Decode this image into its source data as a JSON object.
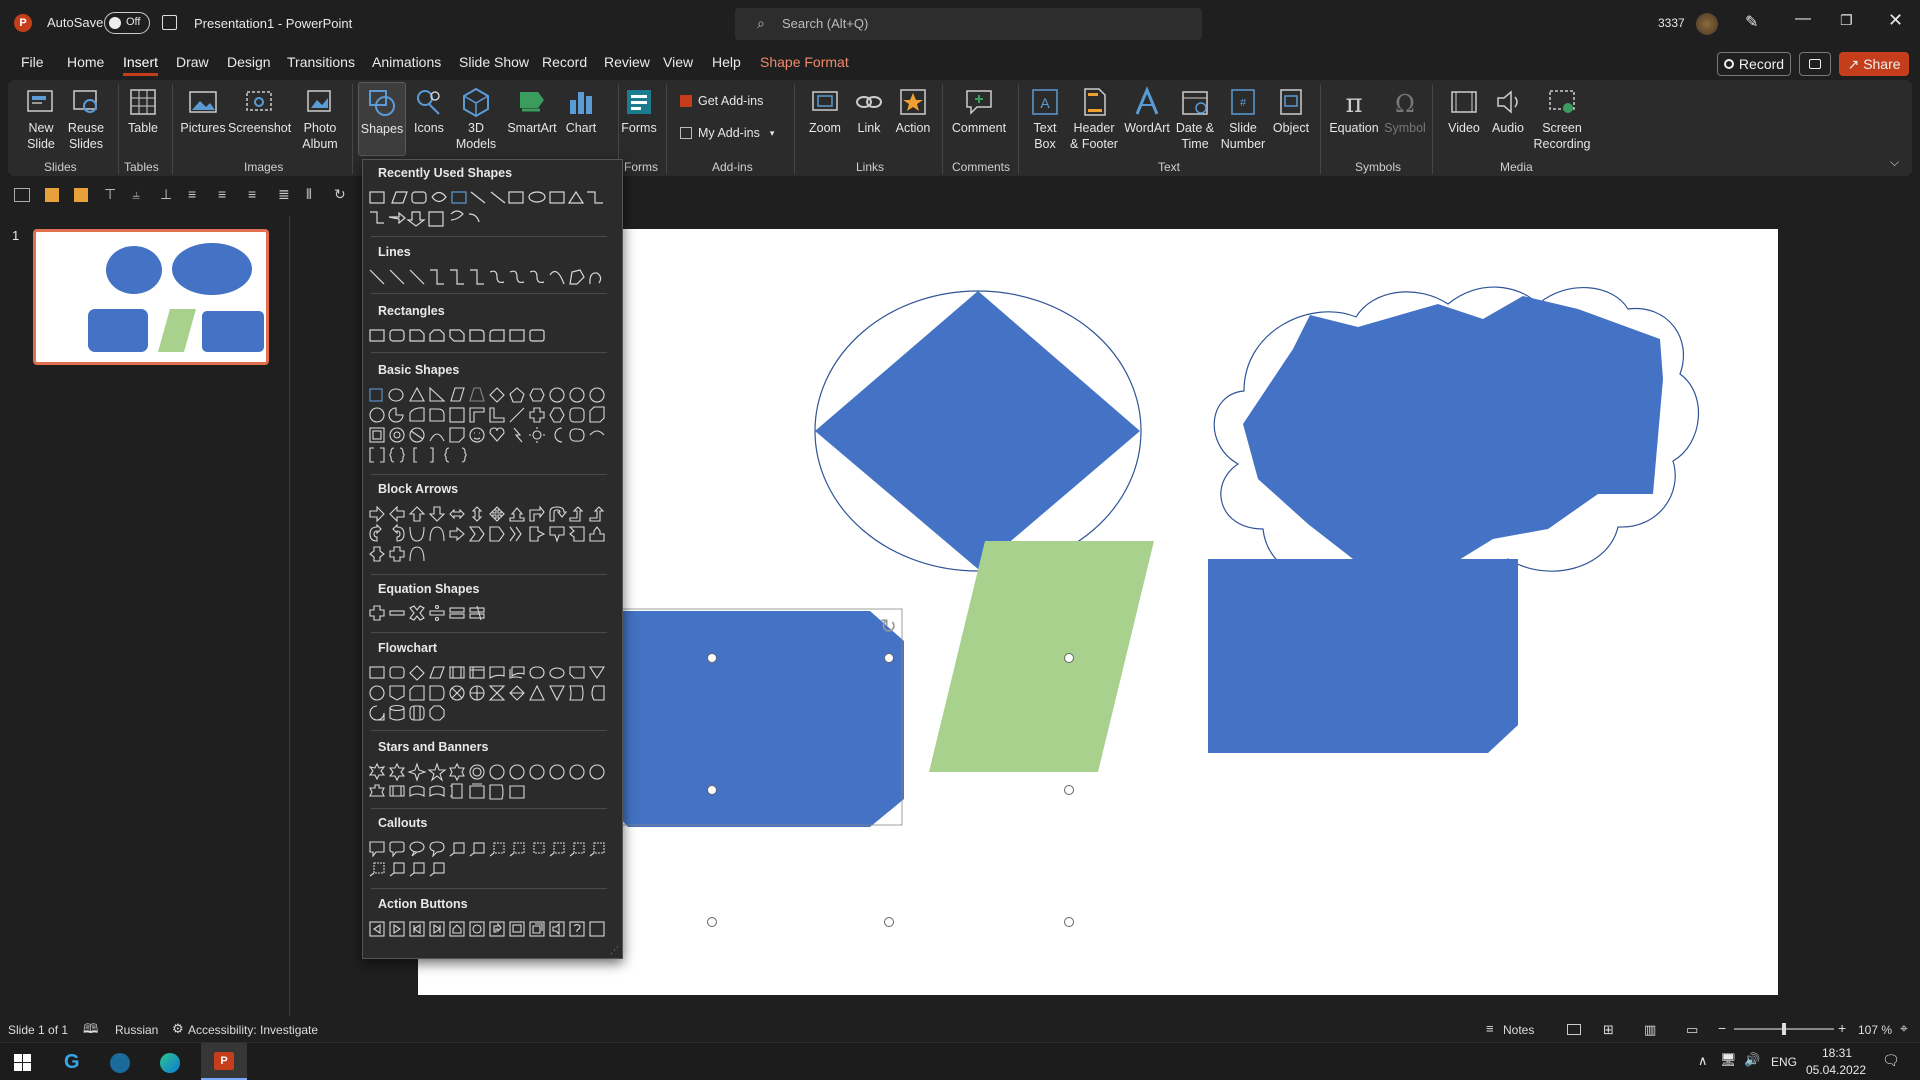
{
  "titlebar": {
    "autosave_label": "AutoSave",
    "autosave_state": "Off",
    "doc_title": "Presentation1  -  PowerPoint",
    "search_placeholder": "Search (Alt+Q)",
    "user_number": "3337"
  },
  "menu": {
    "tabs": [
      "File",
      "Home",
      "Insert",
      "Draw",
      "Design",
      "Transitions",
      "Animations",
      "Slide Show",
      "Record",
      "Review",
      "View",
      "Help",
      "Shape Format"
    ],
    "active_tab": "Insert",
    "record_label": "Record",
    "share_label": "Share"
  },
  "ribbon": {
    "groups": {
      "slides": "Slides",
      "tables": "Tables",
      "images": "Images",
      "forms": "Forms",
      "addins": "Add-ins",
      "links": "Links",
      "comments": "Comments",
      "text": "Text",
      "symbols": "Symbols",
      "media": "Media"
    },
    "buttons": {
      "new_slide": "New\nSlide",
      "reuse_slides": "Reuse\nSlides",
      "table": "Table",
      "pictures": "Pictures",
      "screenshot": "Screenshot",
      "photo_album": "Photo\nAlbum",
      "shapes": "Shapes",
      "icons": "Icons",
      "3d_models": "3D\nModels",
      "smartart": "SmartArt",
      "chart": "Chart",
      "forms": "Forms",
      "get_addins": "Get Add-ins",
      "my_addins": "My Add-ins",
      "zoom": "Zoom",
      "link": "Link",
      "action": "Action",
      "comment": "Comment",
      "text_box": "Text\nBox",
      "header_footer": "Header\n& Footer",
      "wordart": "WordArt",
      "date_time": "Date &\nTime",
      "slide_number": "Slide\nNumber",
      "object": "Object",
      "equation": "Equation",
      "symbol": "Symbol",
      "video": "Video",
      "audio": "Audio",
      "screen_recording": "Screen\nRecording"
    }
  },
  "shapes_panel": {
    "sections": [
      "Recently Used Shapes",
      "Lines",
      "Rectangles",
      "Basic Shapes",
      "Block Arrows",
      "Equation Shapes",
      "Flowchart",
      "Stars and Banners",
      "Callouts",
      "Action Buttons"
    ]
  },
  "thumbnail": {
    "number": "1"
  },
  "status": {
    "slide_info": "Slide 1 of 1",
    "language": "Russian",
    "accessibility": "Accessibility: Investigate",
    "notes": "Notes",
    "zoom": "107 %"
  },
  "taskbar": {
    "lang": "ENG",
    "time": "18:31",
    "date": "05.04.2022"
  },
  "colors": {
    "accent": "#c43e1c",
    "shape_blue": "#4472c4",
    "shape_green": "#a9d18e"
  }
}
